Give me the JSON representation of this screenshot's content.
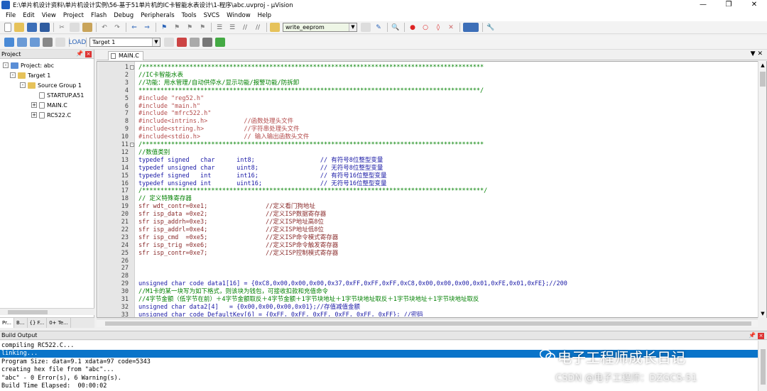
{
  "window": {
    "title": "E:\\单片机设计资料\\单片机设计实例\\56-基于51单片机的IC卡智能水表设计\\1-程序\\abc.uvproj - µVision",
    "controls": [
      "—",
      "❐",
      "✕"
    ]
  },
  "menu": [
    "File",
    "Edit",
    "View",
    "Project",
    "Flash",
    "Debug",
    "Peripherals",
    "Tools",
    "SVCS",
    "Window",
    "Help"
  ],
  "toolbar": {
    "find_combo": "write_eeprom",
    "target_combo": "Target 1"
  },
  "project_panel": {
    "title": "Project",
    "items": [
      {
        "label": "Project: abc",
        "level": 0,
        "icon": "project-icon",
        "expander": "-"
      },
      {
        "label": "Target 1",
        "level": 1,
        "icon": "target-icon",
        "expander": "-"
      },
      {
        "label": "Source Group 1",
        "level": 2,
        "icon": "folder-icon",
        "expander": "-"
      },
      {
        "label": "STARTUP.A51",
        "level": 3,
        "icon": "file-icon",
        "expander": ""
      },
      {
        "label": "MAIN.C",
        "level": 3,
        "icon": "file-icon",
        "expander": "+"
      },
      {
        "label": "RC522.C",
        "level": 3,
        "icon": "file-icon",
        "expander": "+"
      }
    ],
    "tabs": [
      "Pr...",
      "B...",
      "{} F...",
      "0+ Te..."
    ]
  },
  "editor": {
    "active_tab": "MAIN.C",
    "lines": [
      {
        "n": "1",
        "fold": "-",
        "style": "c-comment",
        "text": "/**********************************************************************************************"
      },
      {
        "n": "2",
        "fold": "",
        "style": "c-comment",
        "text": "//IC卡智能水表"
      },
      {
        "n": "3",
        "fold": "",
        "style": "c-comment",
        "text": "//功能：用水管理/自动供停水/显示功能/报警功能/防拆卸"
      },
      {
        "n": "4",
        "fold": "",
        "style": "c-comment",
        "text": "**********************************************************************************************/"
      },
      {
        "n": "5",
        "fold": "",
        "style": "c-pre",
        "text": "#include \"reg52.h\""
      },
      {
        "n": "6",
        "fold": "",
        "style": "c-pre",
        "text": "#include \"main.h\""
      },
      {
        "n": "7",
        "fold": "",
        "style": "c-pre",
        "text": "#include \"mfrc522.h\""
      },
      {
        "n": "8",
        "fold": "",
        "style": "c-pre",
        "text": "#include<intrins.h>          //函数处理头文件"
      },
      {
        "n": "9",
        "fold": "",
        "style": "c-pre",
        "text": "#include<string.h>           //字符串处理头文件"
      },
      {
        "n": "10",
        "fold": "",
        "style": "c-pre",
        "text": "#include<stdio.h>            // 输入输出函数头文件"
      },
      {
        "n": "11",
        "fold": "-",
        "style": "c-comment",
        "text": "/**********************************************************************************************"
      },
      {
        "n": "12",
        "fold": "",
        "style": "c-comment",
        "text": "//数值类别"
      },
      {
        "n": "13",
        "fold": "",
        "style": "c-kw",
        "text": "typedef signed   char      int8;                  // 有符号8位整型变量"
      },
      {
        "n": "14",
        "fold": "",
        "style": "c-kw",
        "text": "typedef unsigned char      uint8;                 // 无符号8位整型变量"
      },
      {
        "n": "15",
        "fold": "",
        "style": "c-kw",
        "text": "typedef signed   int       int16;                 // 有符号16位整型变量"
      },
      {
        "n": "16",
        "fold": "",
        "style": "c-kw",
        "text": "typedef unsigned int       uint16;                // 无符号16位整型变量"
      },
      {
        "n": "17",
        "fold": "",
        "style": "c-comment",
        "text": "/**********************************************************************************************/"
      },
      {
        "n": "18",
        "fold": "",
        "style": "c-comment",
        "text": "// 定义特殊寄存器"
      },
      {
        "n": "19",
        "fold": "",
        "style": "c-sfr",
        "text": "sfr wdt_contr=0xe1;                //定义看门狗地址"
      },
      {
        "n": "20",
        "fold": "",
        "style": "c-sfr",
        "text": "sfr isp_data =0xe2;                //定义ISP数据寄存器"
      },
      {
        "n": "21",
        "fold": "",
        "style": "c-sfr",
        "text": "sfr isp_addrh=0xe3;                //定义ISP地址高8位"
      },
      {
        "n": "22",
        "fold": "",
        "style": "c-sfr",
        "text": "sfr isp_addrl=0xe4;                //定义ISP地址低8位"
      },
      {
        "n": "23",
        "fold": "",
        "style": "c-sfr",
        "text": "sfr isp_cmd  =0xe5;                //定义ISP命令模式寄存器"
      },
      {
        "n": "24",
        "fold": "",
        "style": "c-sfr",
        "text": "sfr isp_trig =0xe6;                //定义ISP命令触发寄存器"
      },
      {
        "n": "25",
        "fold": "",
        "style": "c-sfr",
        "text": "sfr isp_contr=0xe7;                //定义ISP控制模式寄存器"
      },
      {
        "n": "26",
        "fold": "",
        "style": "c-normal",
        "text": ""
      },
      {
        "n": "27",
        "fold": "",
        "style": "c-normal",
        "text": ""
      },
      {
        "n": "28",
        "fold": "",
        "style": "c-normal",
        "text": ""
      },
      {
        "n": "29",
        "fold": "",
        "style": "c-kw",
        "text": "unsigned char code data1[16] = {0xC8,0x00,0x00,0x00,0x37,0xFF,0xFF,0xFF,0xC8,0x00,0x00,0x00,0x01,0xFE,0x01,0xFE};//200"
      },
      {
        "n": "30",
        "fold": "",
        "style": "c-comment",
        "text": "//M1卡的某一块写为如下格式，则该块为钱包，可接收扣款和充值命令"
      },
      {
        "n": "31",
        "fold": "",
        "style": "c-comment",
        "text": "//4字节金额（低字节在前）＋4字节金额取反＋4字节金额＋1字节块地址＋1字节块地址取反＋1字节块地址＋1字节块地址取反"
      },
      {
        "n": "32",
        "fold": "",
        "style": "c-kw",
        "text": "unsigned char data2[4]   = {0x00,0x00,0x00,0x01};//存值减值金额"
      },
      {
        "n": "33",
        "fold": "",
        "style": "c-kw",
        "text": "unsigned char code DefaultKey[6] = {0xFF, 0xFF, 0xFF, 0xFF, 0xFF, 0xFF}; //密码"
      }
    ]
  },
  "build_output": {
    "title": "Build Output",
    "lines": [
      "compiling RC522.C...",
      "linking...",
      "Program Size: data=9.1 xdata=97 code=5343",
      "creating hex file from \"abc\"...",
      "\"abc\" - 0 Error(s), 6 Warning(s).",
      "Build Time Elapsed:  00:00:02"
    ],
    "selected_index": 1
  },
  "watermark": {
    "title": "电子工程师成长日记",
    "subtitle": "CSDN @电子工程师：DZGCS-51"
  }
}
